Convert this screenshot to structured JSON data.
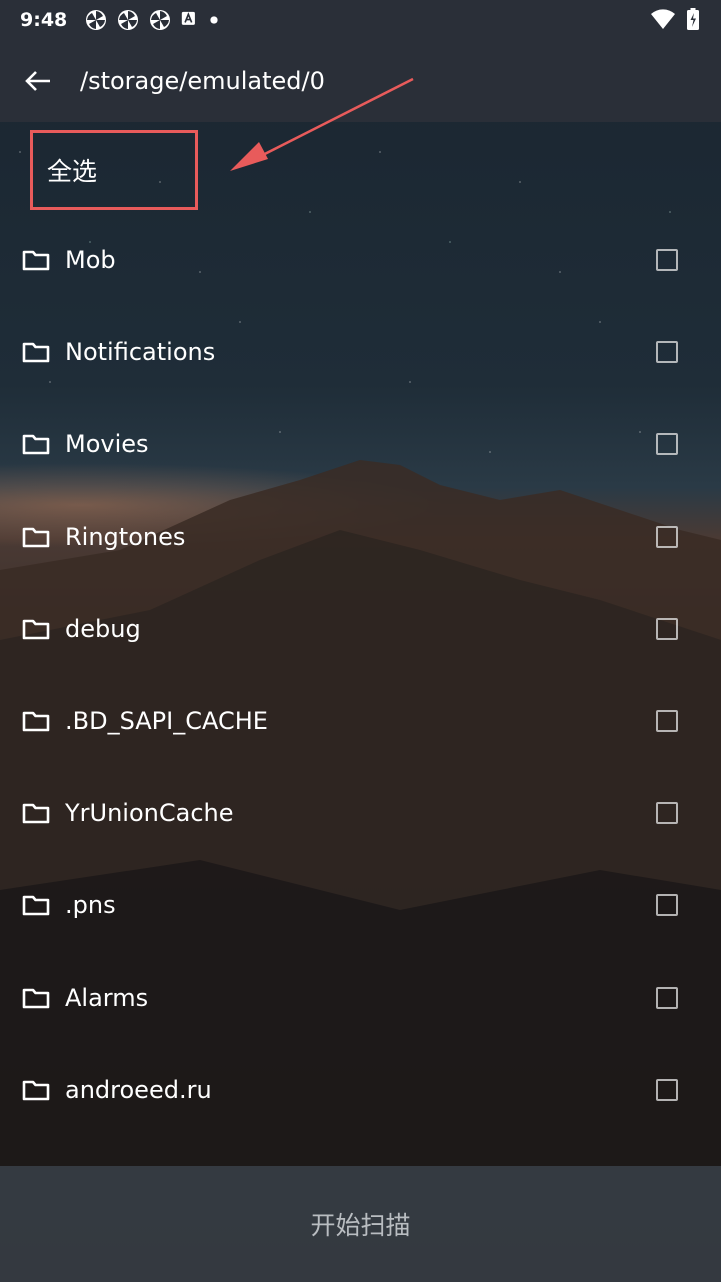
{
  "status_bar": {
    "time": "9:48",
    "notification_icons": [
      "pinwheel-icon",
      "pinwheel-icon",
      "pinwheel-icon",
      "a-icon",
      "dot-icon"
    ],
    "right_icons": [
      "wifi-icon",
      "battery-icon"
    ]
  },
  "app_bar": {
    "back_icon": "arrow-left-icon",
    "path": "/storage/emulated/0"
  },
  "select_all": {
    "label": "全选",
    "highlight_color": "#e85b5b"
  },
  "folders": [
    {
      "name": "Mob",
      "checked": false
    },
    {
      "name": "Notifications",
      "checked": false
    },
    {
      "name": "Movies",
      "checked": false
    },
    {
      "name": "Ringtones",
      "checked": false
    },
    {
      "name": "debug",
      "checked": false
    },
    {
      "name": ".BD_SAPI_CACHE",
      "checked": false
    },
    {
      "name": "YrUnionCache",
      "checked": false
    },
    {
      "name": ".pns",
      "checked": false
    },
    {
      "name": "Alarms",
      "checked": false
    },
    {
      "name": "androeed.ru",
      "checked": false
    }
  ],
  "bottom_button": {
    "label": "开始扫描"
  }
}
